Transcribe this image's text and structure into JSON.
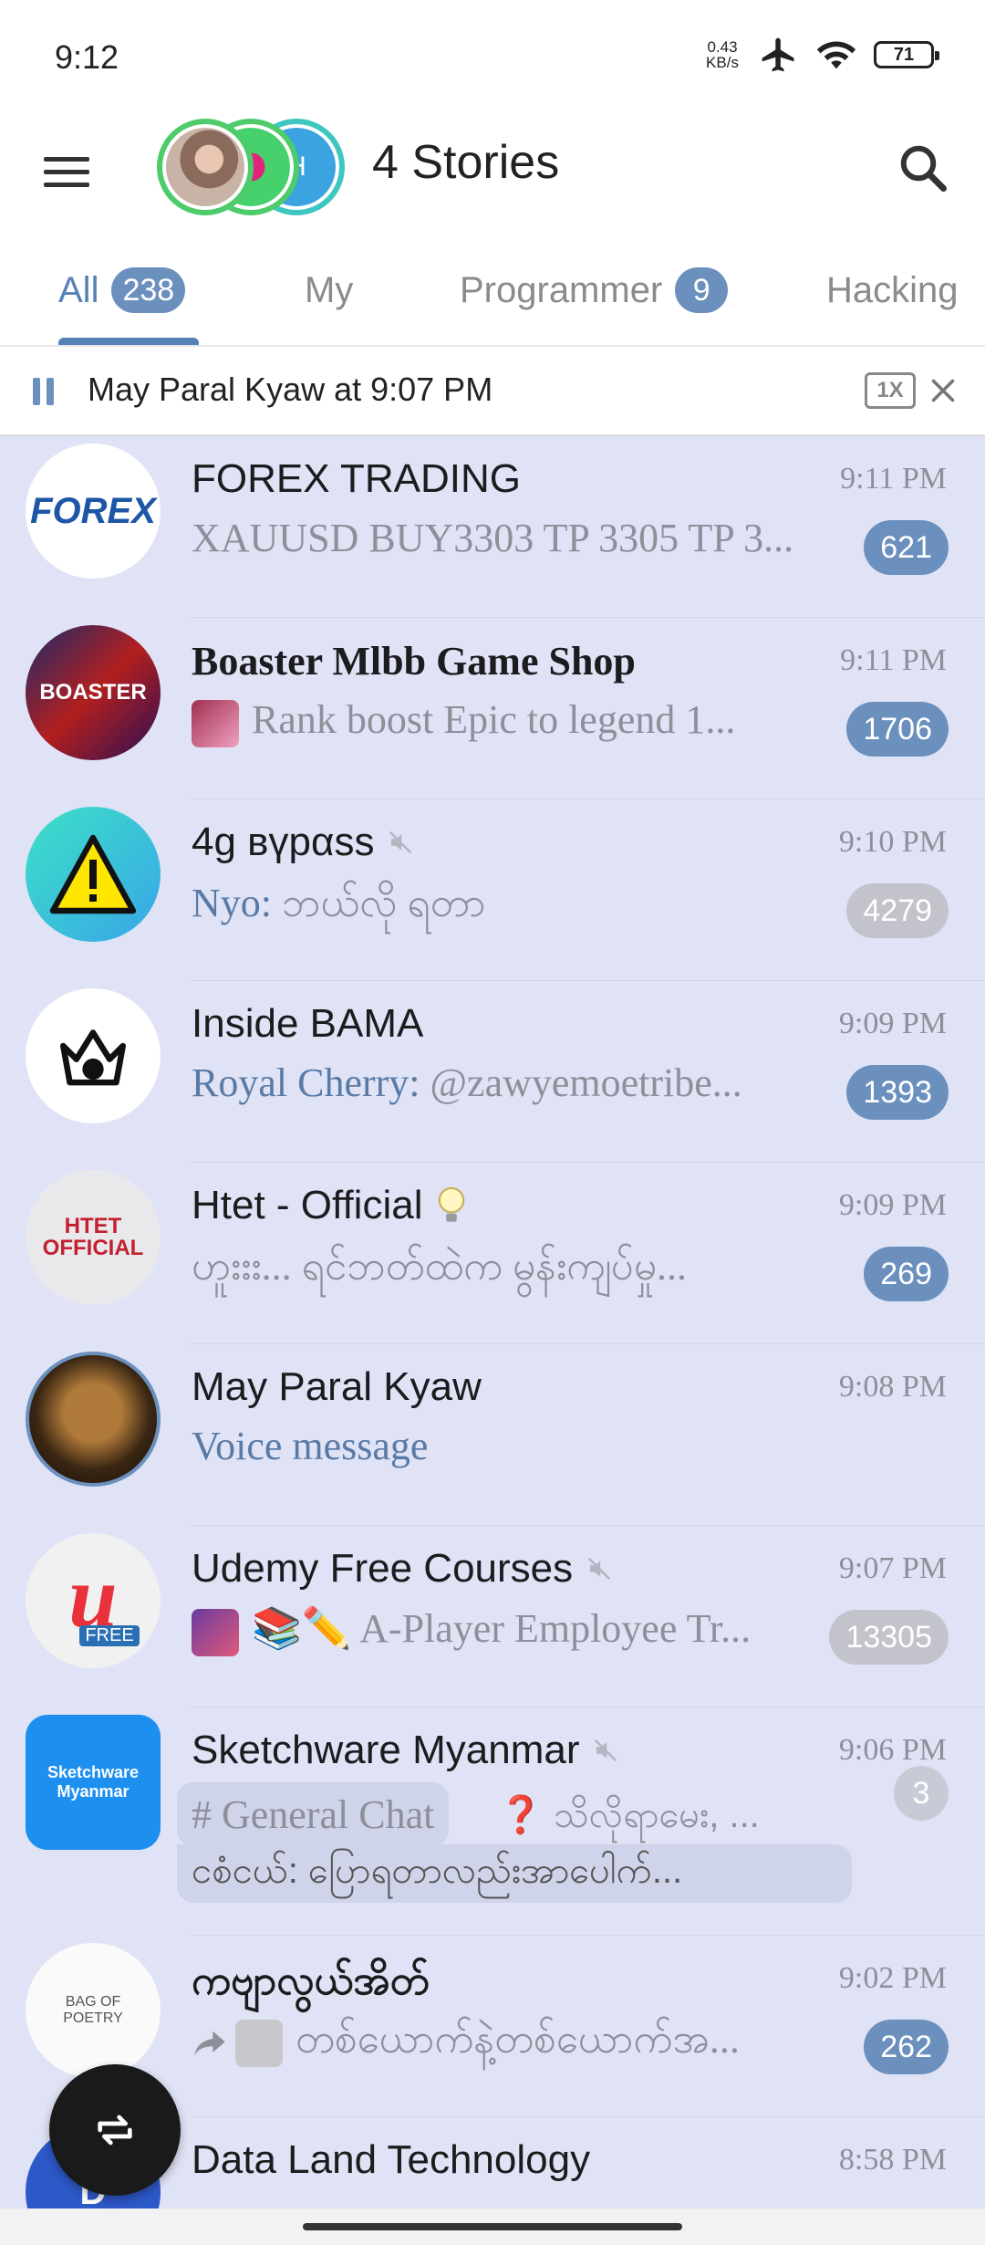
{
  "status_bar": {
    "time": "9:12",
    "net_speed_value": "0.43",
    "net_speed_unit": "KB/s",
    "battery": "71"
  },
  "header": {
    "title": "4 Stories",
    "story_letter": "H"
  },
  "tabs": [
    {
      "label": "All",
      "badge": "238"
    },
    {
      "label": "My",
      "badge": ""
    },
    {
      "label": "Programmer",
      "badge": "9"
    },
    {
      "label": "Hacking",
      "badge": ""
    }
  ],
  "player": {
    "text": "May Paral Kyaw at 9:07 PM",
    "speed": "1X"
  },
  "chats": [
    {
      "name": "FOREX TRADING",
      "time": "9:11 PM",
      "sender": "",
      "message": "XAUUSD BUY3303  TP 3305  TP 3...",
      "unread": "621",
      "muted": false,
      "avatar_text": "FOREX"
    },
    {
      "name": "Boaster Mlbb Game Shop",
      "time": "9:11 PM",
      "sender": "",
      "message": "Rank boost   Epic to legend 1...",
      "unread": "1706",
      "muted": false,
      "avatar_text": "BOASTER"
    },
    {
      "name": "4g вүрαѕѕ",
      "time": "9:10 PM",
      "sender": "Nyo:",
      "message": " ဘယ်လို ရတာ",
      "unread": "4279",
      "muted": true,
      "avatar_text": "!"
    },
    {
      "name": "Inside BAMA",
      "time": "9:09 PM",
      "sender": "Royal Cherry:",
      "message": " @zawyemoetribe...",
      "unread": "1393",
      "muted": false,
      "avatar_text": ""
    },
    {
      "name": "Htet - Official",
      "time": "9:09 PM",
      "sender": "",
      "message": "ဟူးးး... ရင်ဘတ်ထဲက မွန်းကျပ်မှု...",
      "unread": "269",
      "muted": false,
      "avatar_text": "HTET OFFICIAL"
    },
    {
      "name": "May Paral Kyaw",
      "time": "9:08 PM",
      "sender": "",
      "message": "Voice message",
      "unread": "",
      "muted": false,
      "avatar_text": ""
    },
    {
      "name": "Udemy Free Courses",
      "time": "9:07 PM",
      "sender": "",
      "message": "📚✏️ A-Player Employee Tr...",
      "unread": "13305",
      "muted": true,
      "avatar_text": "FREE"
    },
    {
      "name": "Sketchware Myanmar",
      "time": "9:06 PM",
      "topic": "# General Chat",
      "topic_rest": "❓ သိလိုရာမေး, ...",
      "topic_line2": "ငစံငယ်: ပြောရတာလည်းအာပေါက်...",
      "unread": "3",
      "muted": true,
      "avatar_text": "Sketchware Myanmar"
    },
    {
      "name": "ကဗျာလွယ်အိတ်",
      "time": "9:02 PM",
      "sender": "",
      "message": "တစ်ယောက်နဲ့တစ်ယောက်အ...",
      "unread": "262",
      "muted": false,
      "avatar_text": "BAG OF POETRY"
    },
    {
      "name": "Data Land Technology",
      "time": "8:58 PM",
      "sender": "",
      "message": "",
      "unread": "",
      "muted": false,
      "avatar_text": "D"
    }
  ],
  "colors": {
    "accent": "#5681b5",
    "badge": "#6b90be",
    "muted_badge": "#c2c3cb",
    "list_bg": "#dfe3f5"
  }
}
